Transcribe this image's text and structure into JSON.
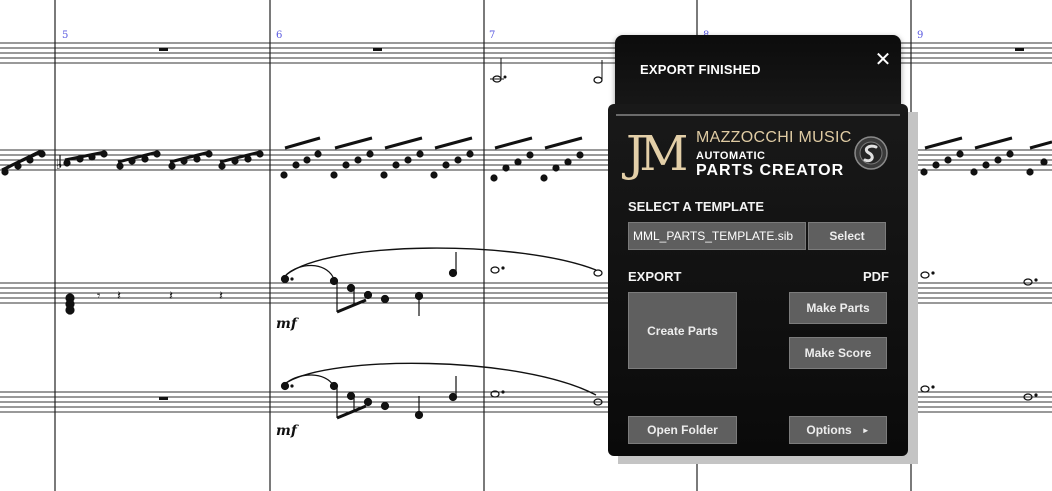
{
  "score": {
    "measure_numbers": [
      "5",
      "6",
      "7",
      "8",
      "9"
    ],
    "dynamics": [
      "mf",
      "mf"
    ]
  },
  "popup": {
    "title": "EXPORT FINISHED",
    "close_glyph": "✕"
  },
  "plugin": {
    "logo_mark": "JM",
    "brand_line1": "MAZZOCCHI MUSIC",
    "brand_line2": "AUTOMATIC",
    "brand_line3": "PARTS CREATOR",
    "seal_icon": "swirl-seal-icon",
    "template_section_label": "SELECT A TEMPLATE",
    "template_value": "MML_PARTS_TEMPLATE.sib",
    "select_button": "Select",
    "export_label": "EXPORT",
    "pdf_label": "PDF",
    "create_parts_button": "Create Parts",
    "make_parts_button": "Make Parts",
    "make_score_button": "Make Score",
    "open_folder_button": "Open Folder",
    "options_button": "Options",
    "options_arrow": "►"
  }
}
